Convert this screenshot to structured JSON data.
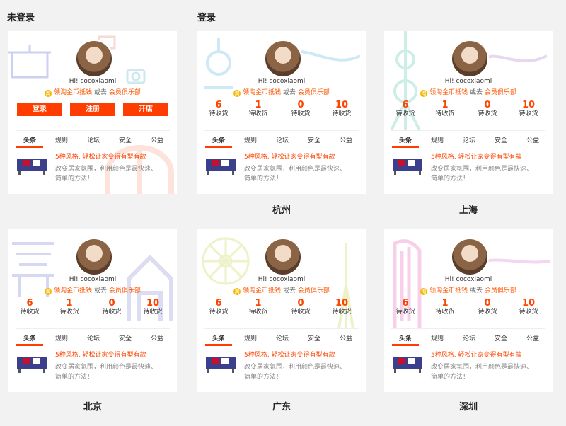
{
  "headings": {
    "not_logged_in": "未登录",
    "logged_in": "登录"
  },
  "profile": {
    "greeting": "Hi! cocoxiaomi",
    "coin_link": "领淘金币抵钱",
    "or_go": "或去",
    "club_link": "会员俱乐部",
    "coin_icon_glyph": "淘"
  },
  "buttons": {
    "login": "登录",
    "register": "注册",
    "open_shop": "开店"
  },
  "stats": [
    {
      "value": "6",
      "label": "待收货"
    },
    {
      "value": "1",
      "label": "待收货"
    },
    {
      "value": "0",
      "label": "待收货"
    },
    {
      "value": "10",
      "label": "待收货"
    }
  ],
  "tabs": [
    "头条",
    "规则",
    "论坛",
    "安全",
    "公益"
  ],
  "news": {
    "title": "5种风格, 轻松让家变得有型有款",
    "desc": "改变居家氛围，利用颜色是最快速、简单的方法！"
  },
  "cities": [
    "杭州",
    "上海",
    "北京",
    "广东",
    "深圳"
  ],
  "colors": {
    "accent": "#ff3d00",
    "coin": "#f5b800"
  }
}
